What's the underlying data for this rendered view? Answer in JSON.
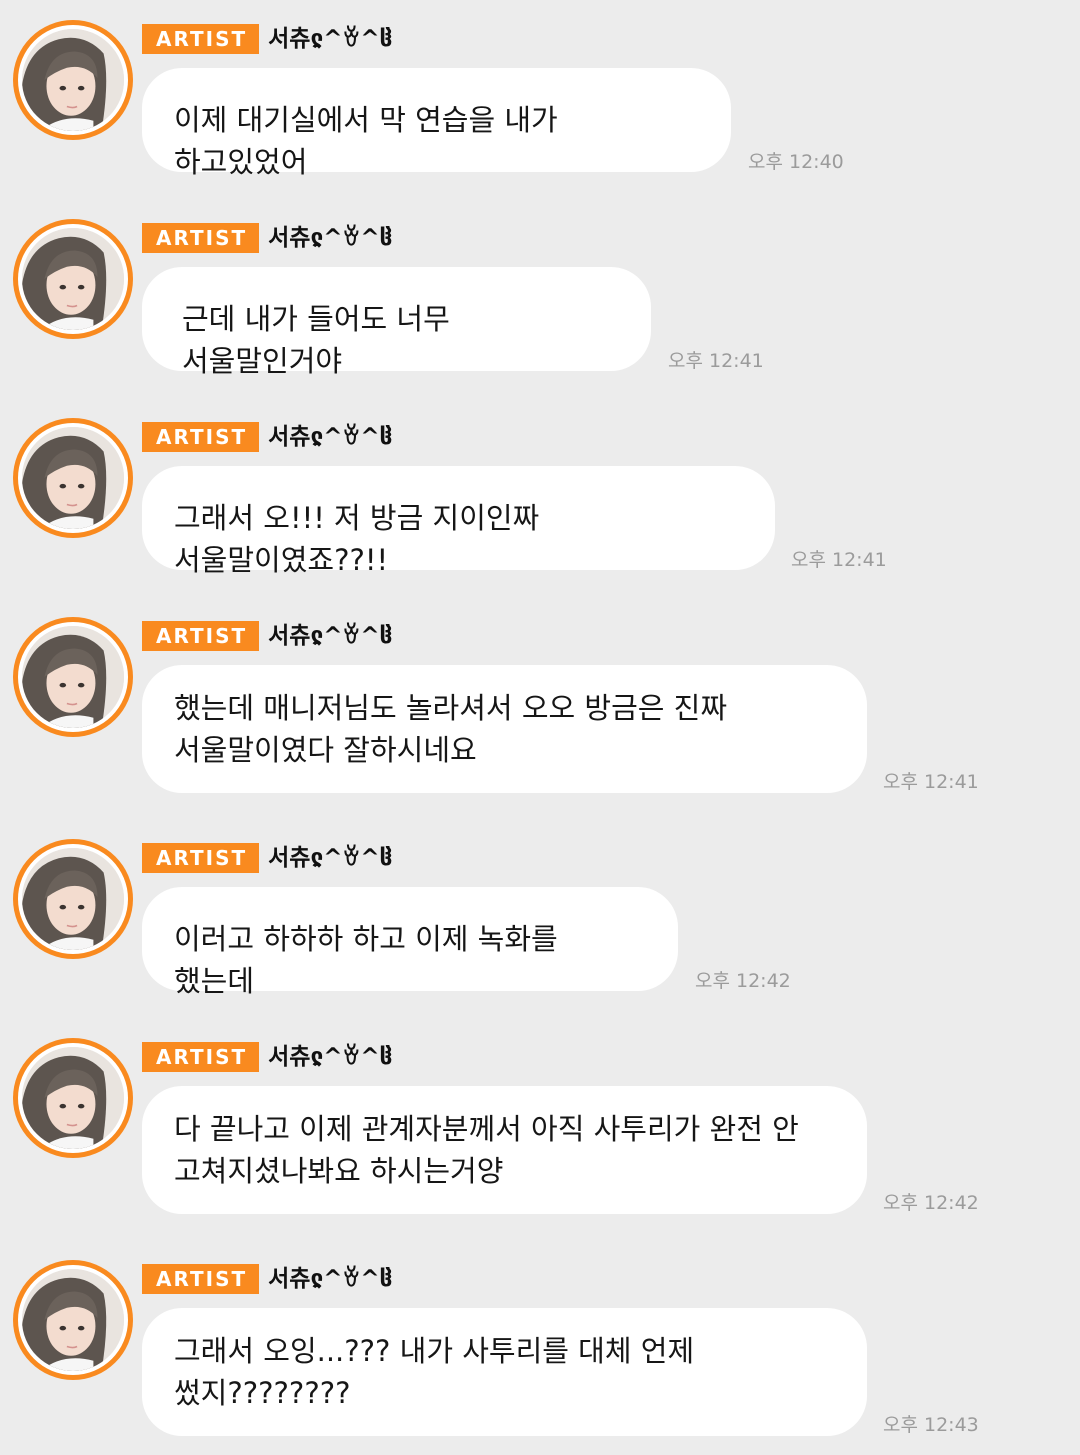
{
  "chat": {
    "messages": [
      {
        "badge": "ARTIST",
        "sender": "서츄ჺ^ꈊ^ჱ",
        "text": "이제 대기실에서 막 연습을 내가 하고있었어",
        "time": "오후 12:40"
      },
      {
        "badge": "ARTIST",
        "sender": "서츄ჺ^ꈊ^ჱ",
        "text": "근데 내가 들어도 너무 서울말인거야",
        "time": "오후 12:41"
      },
      {
        "badge": "ARTIST",
        "sender": "서츄ჺ^ꈊ^ჱ",
        "text": "그래서 오!!! 저 방금 지이인짜 서울말이였죠??!!",
        "time": "오후 12:41"
      },
      {
        "badge": "ARTIST",
        "sender": "서츄ჺ^ꈊ^ჱ",
        "text": "했는데 매니저님도 놀라셔서 오오 방금은 진짜\n서울말이였다 잘하시네요",
        "time": "오후 12:41"
      },
      {
        "badge": "ARTIST",
        "sender": "서츄ჺ^ꈊ^ჱ",
        "text": "이러고 하하하 하고 이제 녹화를 했는데",
        "time": "오후 12:42"
      },
      {
        "badge": "ARTIST",
        "sender": "서츄ჺ^ꈊ^ჱ",
        "text": "다 끝나고 이제 관계자분께서 아직 사투리가 완전 안\n고쳐지셨나봐요 하시는거양",
        "time": "오후 12:42"
      },
      {
        "badge": "ARTIST",
        "sender": "서츄ჺ^ꈊ^ჱ",
        "text": "그래서 오잉...??? 내가 사투리를 대체 언제\n썼지????????",
        "time": "오후 12:43"
      }
    ]
  },
  "colors": {
    "background": "#ececec",
    "accent": "#f98a1f",
    "bubble": "#ffffff",
    "timestamp": "#9b9b9b"
  }
}
